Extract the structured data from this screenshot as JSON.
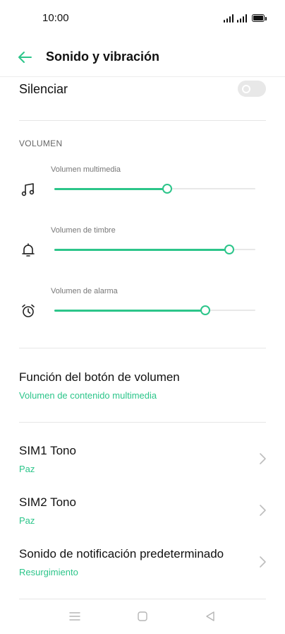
{
  "status_bar": {
    "time": "10:00"
  },
  "header": {
    "title": "Sonido y vibración",
    "back_icon": "arrow-left-icon"
  },
  "silenciar": {
    "label": "Silenciar",
    "enabled": false
  },
  "volume_section": {
    "title": "VOLUMEN",
    "sliders": [
      {
        "label": "Volumen multimedia",
        "icon": "music-note-icon",
        "level": 0.56
      },
      {
        "label": "Volumen de timbre",
        "icon": "bell-icon",
        "level": 0.87
      },
      {
        "label": "Volumen de alarma",
        "icon": "alarm-clock-icon",
        "level": 0.75
      }
    ]
  },
  "volume_button_function": {
    "title": "Función del botón de volumen",
    "value": "Volumen de contenido multimedia"
  },
  "ringtones": [
    {
      "title": "SIM1 Tono",
      "value": "Paz"
    },
    {
      "title": "SIM2 Tono",
      "value": "Paz"
    },
    {
      "title": "Sonido de notificación predeterminado",
      "value": "Resurgimiento"
    }
  ],
  "colors": {
    "accent": "#2cc58a",
    "text": "#111111",
    "divider": "#e6e6e6"
  }
}
